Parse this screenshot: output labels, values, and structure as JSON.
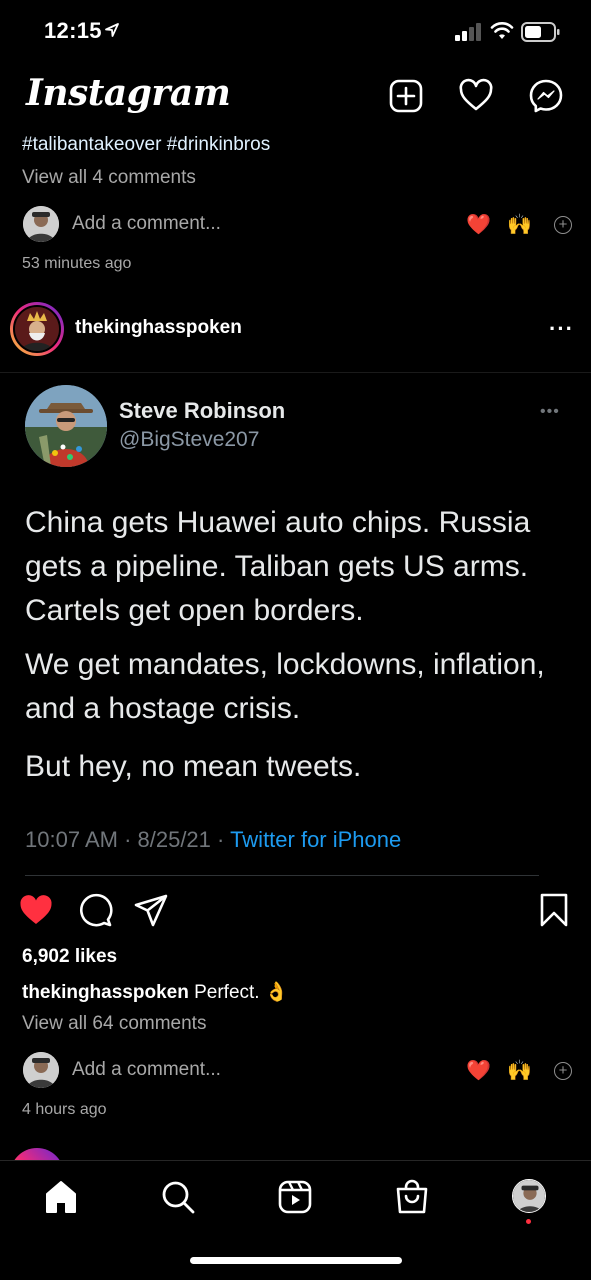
{
  "status_bar": {
    "time": "12:15"
  },
  "header": {
    "logo": "Instagram",
    "icons": [
      "new-post-icon",
      "heart-icon",
      "messenger-icon"
    ]
  },
  "previous_post": {
    "hashtags": "#talibantakeover #drinkinbros",
    "view_comments": "View all 4 comments",
    "add_comment_placeholder": "Add a comment...",
    "quick_emojis": [
      "❤️",
      "🙌"
    ],
    "time_ago": "53 minutes ago"
  },
  "post": {
    "username": "thekinghasspoken",
    "tweet": {
      "name": "Steve Robinson",
      "handle": "@BigSteve207",
      "paragraphs": [
        "China gets Huawei auto chips. Russia gets a pipeline. Taliban gets US arms. Cartels get open borders.",
        "We get mandates, lockdowns, inflation, and a hostage crisis.",
        "But hey, no mean tweets."
      ],
      "time_date": "10:07 AM · 8/25/21 · ",
      "source": "Twitter for iPhone"
    },
    "liked": true,
    "likes": "6,902 likes",
    "caption_user": "thekinghasspoken",
    "caption_text": "Perfect. 👌",
    "view_comments": "View all 64 comments",
    "add_comment_placeholder": "Add a comment...",
    "quick_emojis": [
      "❤️",
      "🙌"
    ],
    "time_ago": "4 hours ago"
  },
  "colors": {
    "like_red": "#ff3040",
    "twitter_blue": "#1d9bf0",
    "muted": "#a8a8a8"
  },
  "tabbar": {
    "tabs": [
      "home-icon",
      "search-icon",
      "reels-icon",
      "shop-icon",
      "profile-avatar"
    ],
    "active": "home-icon"
  }
}
